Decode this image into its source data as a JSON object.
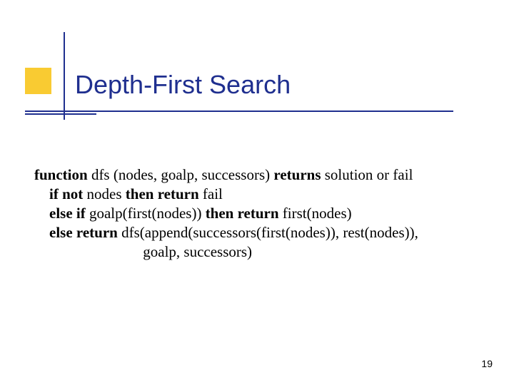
{
  "slide": {
    "title": "Depth-First Search",
    "page_number": "19"
  },
  "code": {
    "kw_function": "function",
    "kw_returns": "returns",
    "kw_if": "if",
    "kw_not": "not",
    "kw_then_return": "then return",
    "kw_else_if": "else if",
    "kw_else_return": "else return",
    "sig_head": " dfs (nodes, goalp, successors) ",
    "sig_tail": " solution or fail",
    "l2_mid": " nodes ",
    "l2_tail": " fail",
    "l3_mid": " goalp(first(nodes)) ",
    "l3_tail": " first(nodes)",
    "l4_tail": " dfs(append(successors(first(nodes)), rest(nodes)),",
    "l5": "                             goalp, successors)"
  }
}
